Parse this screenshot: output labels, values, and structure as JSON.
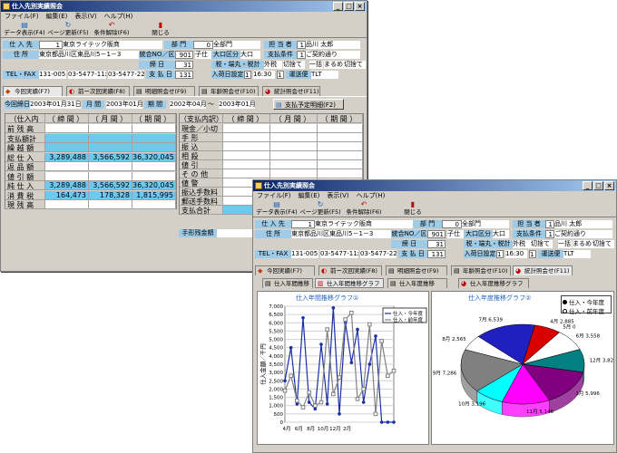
{
  "w1": {
    "title": "仕入先別実績照会",
    "menu": [
      "ファイル(F)",
      "編集(E)",
      "表示(V)",
      "ヘルプ(H)"
    ],
    "tools": [
      {
        "icon": "grid-icon",
        "label": "データ表示(F4)"
      },
      {
        "icon": "refresh-icon",
        "label": "ページ更新(F5)"
      },
      {
        "icon": "undo-icon",
        "label": "条件解除(F6)"
      },
      {
        "icon": "close-doc-icon",
        "label": "閉じる"
      }
    ],
    "supplier_label": "仕 入 先",
    "supplier_code": "1",
    "supplier_name": "東京ライテック販商",
    "dept_label": "部 門",
    "dept_code": "0",
    "dept_name": "全部門",
    "staff_label": "担 当 者",
    "staff_code": "1",
    "staff_name": "品川 太郎",
    "addr_label": "住 所",
    "addr": "東京都品川区東品川5－1－3",
    "summary_label": "統合NO／区",
    "summary_no": "901",
    "summary_kind": "子仕",
    "ozaki_label": "大口区分",
    "ozaki": "大口",
    "pay_cond_label": "支払条件",
    "pay_cond_code": "1",
    "pay_cond": "ご契約通り",
    "close_label": "締 日",
    "close_day": "31",
    "tax_label": "税・端丸・税計",
    "tax_a": "外税",
    "tax_b": "切捨て",
    "tax_c": "一括",
    "tax_d": "まるめ",
    "tax_e": "切捨て",
    "tel_label": "TEL・FAX",
    "tel_code": "131-0055",
    "tel": "03-5477-11xx",
    "fax": "03-5477-22xx",
    "payday_label": "支 払 日",
    "payday": "131",
    "entry_label": "入荷日設定",
    "entry_code": "1",
    "entry_time": "16:30",
    "entry_day": "1",
    "ship_label": "運送便",
    "ship": "TLT",
    "tabs": [
      {
        "icon": "bag-icon",
        "label": "今回実績(F7)"
      },
      {
        "icon": "chart-icon",
        "label": "前ー次回実績(F8)"
      },
      {
        "icon": "doc-icon",
        "label": "明細照会せ(F9)"
      },
      {
        "icon": "doc-icon",
        "label": "年齢照会せ(F10)"
      },
      {
        "icon": "pie-icon",
        "label": "統計照会せ(F11)"
      }
    ],
    "date_label": "今回締日",
    "date_val": "2003年01月31日",
    "month_label": "月 間",
    "month_val": "2003年01月",
    "period_label": "期 間",
    "period_from": "2002年04月",
    "period_tilde": "～",
    "period_to": "2003年01月",
    "pay_plan_btn": "支払予定明細(F2)",
    "left_headers": [
      "（仕入内訳）",
      "（ 締 間 ）",
      "（ 月 間 ）",
      "（ 期 間 ）"
    ],
    "left_rows": [
      {
        "label": "前 残 高",
        "a": "",
        "b": "",
        "c": ""
      },
      {
        "label": "支払額計",
        "a": "",
        "b": "",
        "c": ""
      },
      {
        "label": "繰 越 額",
        "a": "",
        "b": "",
        "c": ""
      },
      {
        "label": "総 仕 入",
        "a": "3,289,488",
        "b": "3,566,592",
        "c": "36,320,045"
      },
      {
        "label": "返 品 額",
        "a": "",
        "b": "",
        "c": ""
      },
      {
        "label": "値 引 額",
        "a": "",
        "b": "",
        "c": ""
      },
      {
        "label": "純 仕 入",
        "a": "3,289,488",
        "b": "3,566,592",
        "c": "36,320,045"
      },
      {
        "label": "消 費 税",
        "a": "164,473",
        "b": "178,328",
        "c": "1,815,995"
      },
      {
        "label": "現 残 高",
        "a": "",
        "b": "",
        "c": ""
      }
    ],
    "right_headers": [
      "（支払内訳）",
      "（ 締 間 ）",
      "（ 月 間 ）",
      "（ 期 間 ）"
    ],
    "right_rows": [
      "現金／小切手",
      "手 形",
      "振 込",
      "相 殺",
      "値 引",
      "そ の 他",
      "値 警",
      "振込手数料",
      "郵送手数料",
      "支払合計"
    ],
    "due_label": "手形残金額"
  },
  "w2": {
    "title": "仕入先別実績照会",
    "subtabs": [
      {
        "icon": "doc-icon",
        "label": "仕入年間推移"
      },
      {
        "icon": "bar-chart-icon",
        "label": "仕入年間推移グラフ"
      },
      {
        "icon": "doc-icon",
        "label": "仕入年度推移"
      },
      {
        "icon": "pie-icon",
        "label": "仕入年度推移グラフ"
      }
    ],
    "radio": [
      "仕入・今年度",
      "仕入・前年度"
    ]
  },
  "chart_data": [
    {
      "type": "line",
      "title": "仕入年間推移グラフ①",
      "ylabel": "仕入金額／千円",
      "ylim": [
        0,
        7000
      ],
      "yticks": [
        "7,000",
        "6,500",
        "6,000",
        "5,500",
        "5,000",
        "4,500",
        "4,000",
        "3,500",
        "3,000",
        "2,500",
        "2,000",
        "1,500",
        "1,000",
        "500",
        "0"
      ],
      "xticks": [
        "4月",
        "6月",
        "8月",
        "10月",
        "12月",
        "2月"
      ],
      "series": [
        {
          "name": "仕入・今年度",
          "color": "#1a2fa6",
          "values": [
            2500,
            4500,
            1100,
            6300,
            1200,
            800,
            4700,
            1100,
            6900,
            500,
            6000,
            3600,
            5600,
            1200,
            3500,
            5200,
            0,
            0,
            0
          ]
        },
        {
          "name": "仕入・前年度",
          "color": "#808080",
          "values": [
            1900,
            2800,
            1300,
            900,
            1800,
            1000,
            1200,
            5600,
            1700,
            2700,
            6200,
            6600,
            1400,
            2000,
            5900,
            500,
            4900,
            2800,
            3100
          ]
        }
      ]
    },
    {
      "type": "pie",
      "title": "仕入年度推移グラフ②",
      "labels": [
        "4月 2,885",
        "5月 0",
        "6月 3,558",
        "12月 3,828",
        "1月 5,996",
        "11月 5,146",
        "10月 3,196",
        "9月 7,286",
        "8月 2,565",
        "7月 6,539"
      ],
      "colors": [
        "#d90000",
        "#0000c0",
        "#ffffff",
        "#008080",
        "#800080",
        "#ff00ff",
        "#00ffff",
        "#808080",
        "#ffffff",
        "#2020c0"
      ]
    }
  ]
}
